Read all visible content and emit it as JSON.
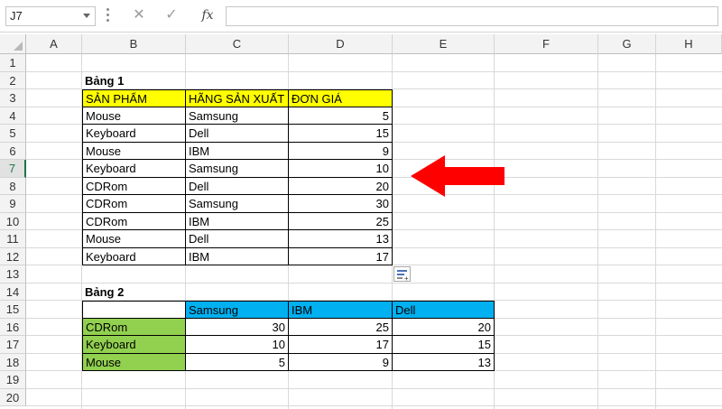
{
  "formula_bar": {
    "name_box": "J7",
    "cancel_glyph": "✕",
    "enter_glyph": "✓",
    "fx_label": "fx",
    "formula": ""
  },
  "columns": [
    "A",
    "B",
    "C",
    "D",
    "E",
    "F",
    "G",
    "H"
  ],
  "rows": [
    "1",
    "2",
    "3",
    "4",
    "5",
    "6",
    "7",
    "8",
    "9",
    "10",
    "11",
    "12",
    "13",
    "14",
    "15",
    "16",
    "17",
    "18",
    "19",
    "20"
  ],
  "active_row": "7",
  "table1": {
    "title": "Bảng 1",
    "headers": [
      "SẢN PHẨM",
      "HÃNG SẢN XUẤT",
      "ĐƠN GIÁ"
    ],
    "header_color": "#ffff00",
    "rows": [
      [
        "Mouse",
        "Samsung",
        "5"
      ],
      [
        "Keyboard",
        "Dell",
        "15"
      ],
      [
        "Mouse",
        "IBM",
        "9"
      ],
      [
        "Keyboard",
        "Samsung",
        "10"
      ],
      [
        "CDRom",
        "Dell",
        "20"
      ],
      [
        "CDRom",
        "Samsung",
        "30"
      ],
      [
        "CDRom",
        "IBM",
        "25"
      ],
      [
        "Mouse",
        "Dell",
        "13"
      ],
      [
        "Keyboard",
        "IBM",
        "17"
      ]
    ]
  },
  "table2": {
    "title": "Bảng 2",
    "col_headers": [
      "Samsung",
      "IBM",
      "Dell"
    ],
    "header_color": "#00b0f0",
    "row_label_color": "#92d050",
    "rows": [
      {
        "label": "CDRom",
        "values": [
          "30",
          "25",
          "20"
        ]
      },
      {
        "label": "Keyboard",
        "values": [
          "10",
          "17",
          "15"
        ]
      },
      {
        "label": "Mouse",
        "values": [
          "5",
          "9",
          "13"
        ]
      }
    ]
  },
  "annotation": {
    "arrow_color": "#ff0000",
    "icon": "left-arrow-icon"
  }
}
